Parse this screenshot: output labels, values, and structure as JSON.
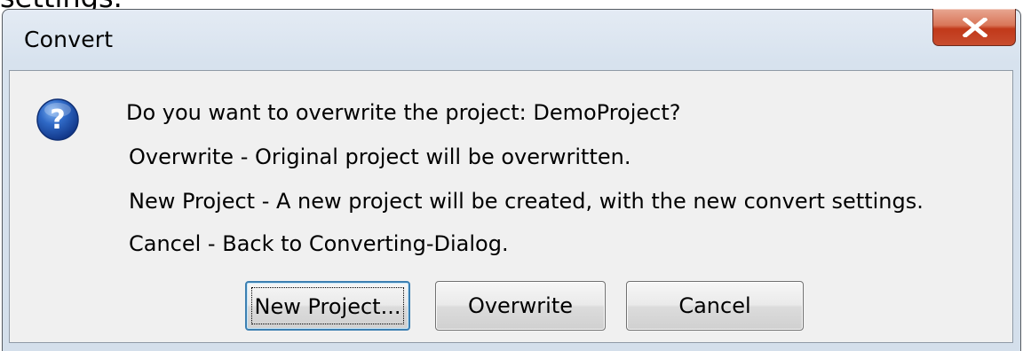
{
  "background": {
    "clipped_text": "settings."
  },
  "window": {
    "title": "Convert",
    "close_glyph": "X"
  },
  "dialog": {
    "icon": "question-icon",
    "message": "Do you want to overwrite the project: DemoProject?",
    "details": [
      "Overwrite - Original project will be overwritten.",
      "New Project - A new project will be created, with the new convert settings.",
      "Cancel - Back to Converting-Dialog."
    ]
  },
  "buttons": {
    "new_project": "New Project...",
    "overwrite": "Overwrite",
    "cancel": "Cancel"
  },
  "colors": {
    "title_bar": "#d7e2ee",
    "content_bg": "#f0f0f0",
    "close_button": "#c84c2e",
    "default_button_border": "#3c7fb1",
    "icon_blue": "#1b4fa8"
  }
}
